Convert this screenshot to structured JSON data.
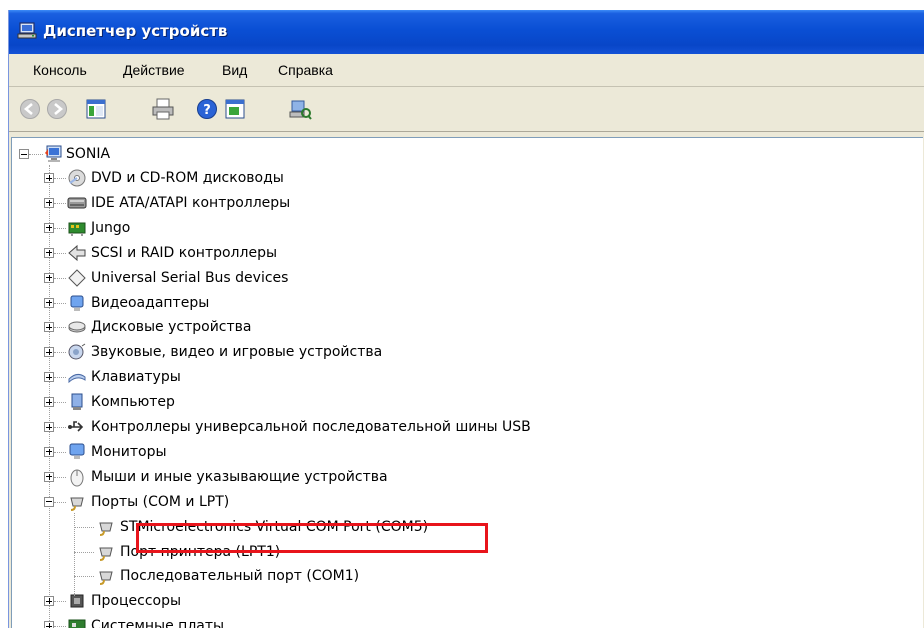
{
  "window": {
    "title": "Диспетчер устройств"
  },
  "menu": {
    "items": [
      "Консоль",
      "Действие",
      "Вид",
      "Справка"
    ]
  },
  "toolbar": {
    "buttons": [
      "back-icon",
      "forward-icon",
      "show-hide-tree-icon",
      "print-icon",
      "help-icon",
      "properties-icon",
      "scan-hardware-icon"
    ]
  },
  "tree": {
    "root": "SONIA",
    "categories": [
      "DVD и CD-ROM дисководы",
      "IDE ATA/ATAPI контроллеры",
      "Jungo",
      "SCSI и RAID контроллеры",
      "Universal Serial Bus devices",
      "Видеоадаптеры",
      "Дисковые устройства",
      "Звуковые, видео и игровые устройства",
      "Клавиатуры",
      "Компьютер",
      "Контроллеры универсальной последовательной шины USB",
      "Мониторы",
      "Мыши и иные указывающие устройства",
      "Порты (COM и LPT)"
    ],
    "ports_children": [
      "STMicroelectronics Virtual COM Port (COM5)",
      "Порт принтера (LPT1)",
      "Последовательный порт (COM1)"
    ],
    "after": [
      "Процессоры",
      "Системные платы"
    ]
  },
  "colors": {
    "highlight": "#e8141b",
    "titlebar": "#0a4fd4"
  }
}
